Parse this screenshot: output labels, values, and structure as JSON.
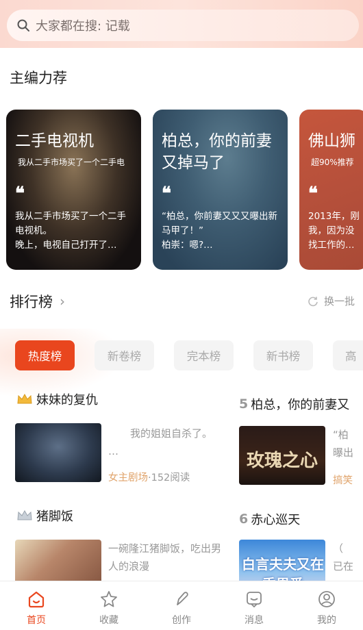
{
  "search": {
    "placeholder": "大家都在搜: 记载"
  },
  "editor_section": {
    "title": "主编力荐"
  },
  "editor_cards": [
    {
      "title": "二手电视机",
      "subtitle": "我从二手市场买了一个二手电",
      "excerpt": "我从二手市场买了一个二手电视机。\n晚上，电视自己打开了…"
    },
    {
      "title": "柏总，你的前妻又掉马了",
      "subtitle": "",
      "excerpt": "“柏总，你前妻又又又曝出新马甲了！”\n柏崇：嗯?…"
    },
    {
      "title": "佛山狮",
      "subtitle": "超90%推荐",
      "excerpt": "2013年，刚我，因为没找工作的…"
    }
  ],
  "ranking": {
    "title": "排行榜",
    "refresh_label": "换一批",
    "tabs": [
      "热度榜",
      "新卷榜",
      "完本榜",
      "新书榜",
      "高"
    ]
  },
  "ranked_books": [
    {
      "rank_label": "",
      "title": "妹妹的复仇",
      "desc": "我的姐姐自杀了。\n…",
      "tag": "女主剧场",
      "reads": "152阅读"
    },
    {
      "rank_label": "5",
      "title": "柏总，你的前妻又",
      "desc": "“柏\n曝出",
      "tag": "搞笑",
      "reads": ""
    },
    {
      "rank_label": "",
      "title": "猪脚饭",
      "desc": "一碗隆江猪脚饭，吃出男人的浪漫",
      "tag": "",
      "reads": ""
    },
    {
      "rank_label": "6",
      "title": "赤心巡天",
      "desc": "（\n已在",
      "tag": "",
      "reads": ""
    }
  ],
  "cover_text": {
    "book2": "玫瑰之心",
    "book4": "白言夫夫又在秀恩爱"
  },
  "tabbar": [
    {
      "label": "首页",
      "icon": "home-icon",
      "active": true
    },
    {
      "label": "收藏",
      "icon": "star-icon",
      "active": false
    },
    {
      "label": "创作",
      "icon": "pen-icon",
      "active": false
    },
    {
      "label": "消息",
      "icon": "message-icon",
      "active": false
    },
    {
      "label": "我的",
      "icon": "profile-icon",
      "active": false
    }
  ],
  "colors": {
    "accent": "#e9461e",
    "tag": "#e0a36a",
    "muted": "#999999"
  }
}
